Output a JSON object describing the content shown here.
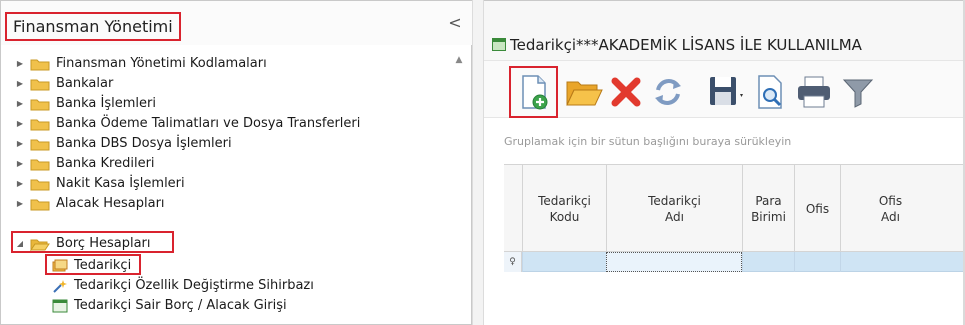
{
  "left_panel": {
    "title": "Finansman Yönetimi",
    "collapse_glyph": "<",
    "scroll_glyph": "▲",
    "tree": [
      {
        "label": "Finansman Yönetimi Kodlamaları",
        "expanded": false
      },
      {
        "label": "Bankalar",
        "expanded": false
      },
      {
        "label": "Banka İşlemleri",
        "expanded": false
      },
      {
        "label": "Banka Ödeme Talimatları ve Dosya Transferleri",
        "expanded": false
      },
      {
        "label": "Banka DBS Dosya İşlemleri",
        "expanded": false
      },
      {
        "label": "Banka Kredileri",
        "expanded": false
      },
      {
        "label": "Nakit Kasa İşlemleri",
        "expanded": false
      },
      {
        "label": "Alacak Hesapları",
        "expanded": false
      },
      {
        "label": "Borç Hesapları",
        "expanded": true
      }
    ],
    "sub_items": [
      {
        "label": "Tedarikçi",
        "icon": "folder-open-icon"
      },
      {
        "label": "Tedarikçi Özellik Değiştirme Sihirbazı",
        "icon": "wizard-icon"
      },
      {
        "label": "Tedarikçi Sair Borç / Alacak Girişi",
        "icon": "form-icon"
      }
    ]
  },
  "right_panel": {
    "window_title": "Tedarikçi***AKADEMİK LİSANS İLE KULLANILMA",
    "toolbar": [
      {
        "name": "new-record-button",
        "icon": "new-document-icon"
      },
      {
        "name": "open-button",
        "icon": "folder-open-icon"
      },
      {
        "name": "delete-button",
        "icon": "red-x-icon"
      },
      {
        "name": "refresh-button",
        "icon": "refresh-icon"
      },
      {
        "name": "save-button",
        "icon": "floppy-disk-icon"
      },
      {
        "name": "preview-button",
        "icon": "print-preview-icon"
      },
      {
        "name": "print-button",
        "icon": "printer-icon"
      },
      {
        "name": "filter-button",
        "icon": "funnel-icon"
      }
    ],
    "group_hint": "Gruplamak için bir sütun başlığını buraya sürükleyin",
    "columns": [
      "Tedarikçi\nKodu",
      "Tedarikçi\nAdı",
      "Para\nBirimi",
      "Ofis",
      "Ofis\nAdı"
    ],
    "row_indicator": "♀"
  },
  "colors": {
    "highlight": "#d9232e",
    "selected_row": "#cfe4f4",
    "folder": "#f0c14b"
  }
}
